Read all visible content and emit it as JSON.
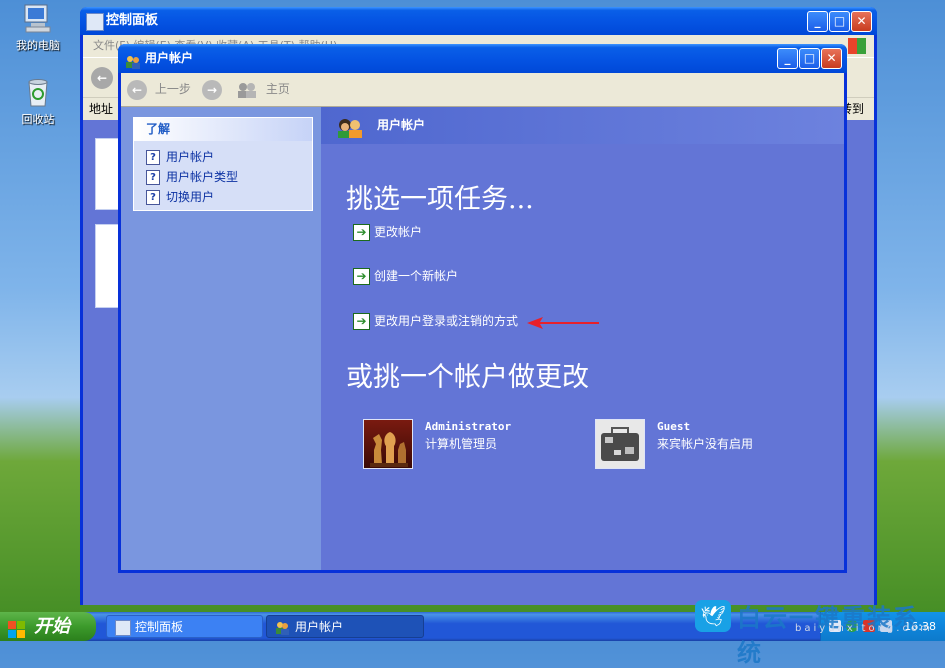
{
  "desktop": {
    "icons": [
      {
        "label": "我的电脑",
        "icon": "my-computer-icon"
      },
      {
        "label": "回收站",
        "icon": "recycle-bin-icon"
      }
    ]
  },
  "control_panel": {
    "title": "控制面板",
    "menu": "文件(F)   编辑(E)   查看(V)   收藏(A)   工具(T)   帮助(H)",
    "address_label": "地址",
    "go_label": "转到"
  },
  "user_accounts": {
    "title": "用户帐户",
    "toolbar": {
      "back": "上一步",
      "home": "主页"
    },
    "learn": {
      "heading": "了解",
      "items": [
        "用户帐户",
        "用户帐户类型",
        "切换用户"
      ]
    },
    "header": "用户帐户",
    "pick_task": "挑选一项任务...",
    "tasks": [
      "更改帐户",
      "创建一个新帐户",
      "更改用户登录或注销的方式"
    ],
    "pick_account": "或挑一个帐户做更改",
    "accounts": [
      {
        "name": "Administrator",
        "desc": "计算机管理员",
        "icon": "chess-pieces-icon"
      },
      {
        "name": "Guest",
        "desc": "来宾帐户没有启用",
        "icon": "suitcase-icon"
      }
    ]
  },
  "taskbar": {
    "start_label": "开始",
    "buttons": [
      "控制面板",
      "用户帐户"
    ],
    "time": "16:38"
  },
  "watermark": {
    "text": "白云一键重装系统",
    "sub": "baiyunxitong.com"
  },
  "colors": {
    "title_blue": "#0554e3",
    "panel_blue": "#6375d6",
    "annotation_arrow": "#e8202a"
  }
}
